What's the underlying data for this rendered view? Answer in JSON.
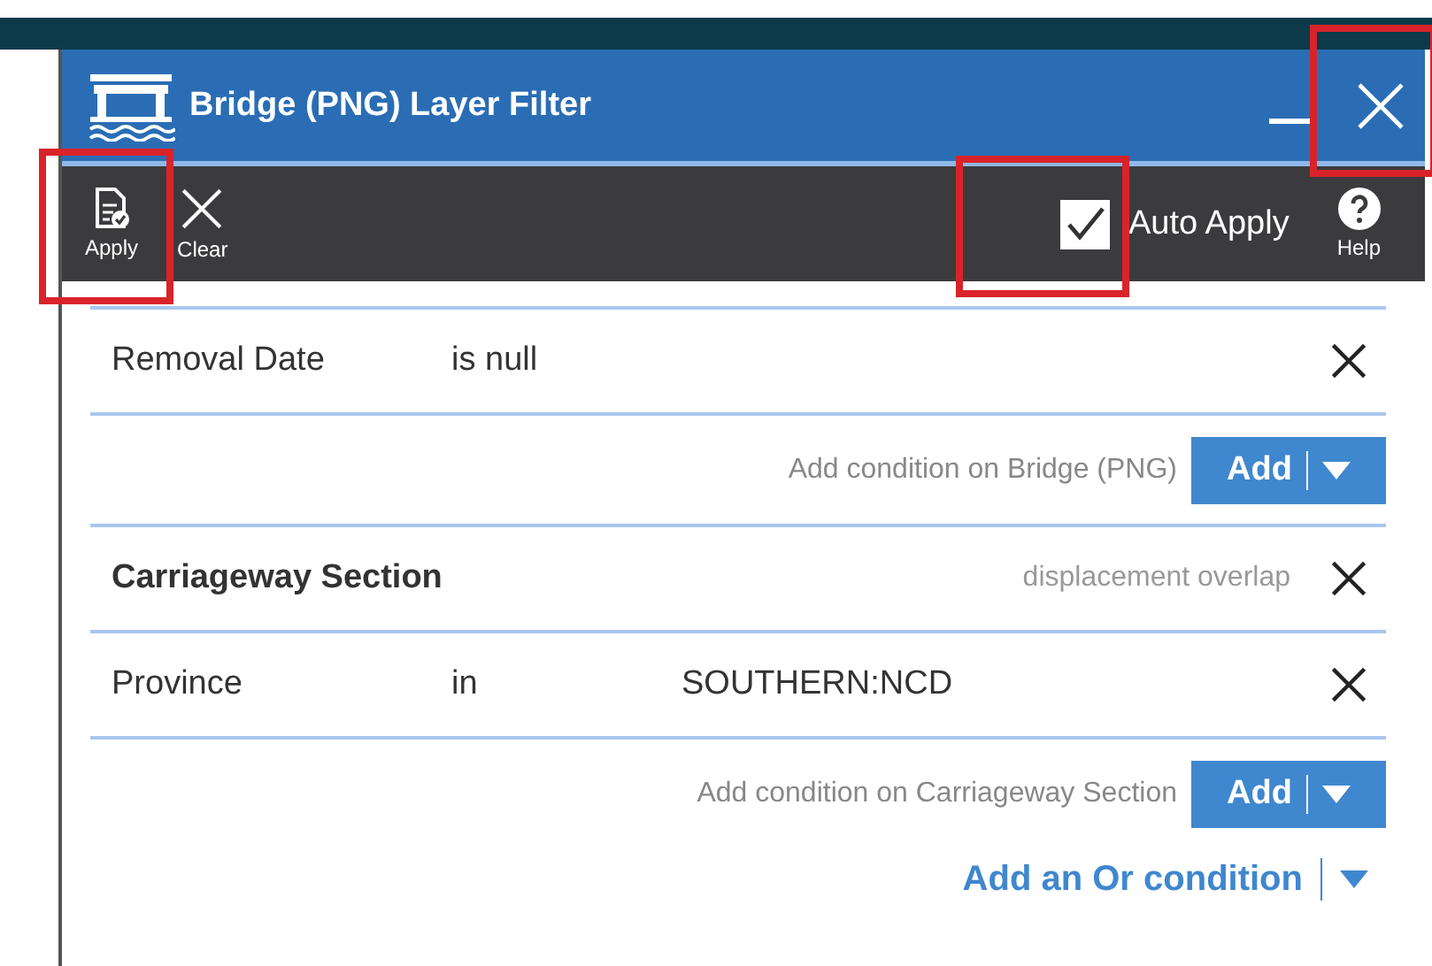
{
  "window": {
    "title": "Bridge (PNG) Layer Filter"
  },
  "toolbar": {
    "buttons": [
      {
        "kind": "apply",
        "label": "Apply"
      },
      {
        "kind": "clear",
        "label": "Clear"
      }
    ],
    "auto_apply": {
      "label": "Auto Apply",
      "checked": true
    },
    "help": {
      "label": "Help"
    }
  },
  "groups": [
    {
      "conditions": [
        {
          "field": "Removal Date",
          "operator": "is null"
        }
      ],
      "add_label": "Add condition on Bridge (PNG)",
      "add_button": "Add"
    },
    {
      "heading": "Carriageway Section",
      "relation": "displacement overlap",
      "conditions": [
        {
          "field": "Province",
          "operator": "in",
          "value": "SOUTHERN:NCD"
        }
      ],
      "add_label": "Add condition on Carriageway Section",
      "add_button": "Add"
    }
  ],
  "or_condition": "Add an Or condition"
}
